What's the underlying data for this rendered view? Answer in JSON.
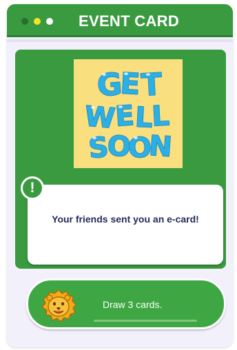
{
  "window": {
    "title": "EVENT CARD",
    "controls": [
      "window-dot-dark",
      "window-dot-yellow",
      "window-dot-white"
    ]
  },
  "event_card": {
    "artwork_text": "GET WELL SOON",
    "alert_glyph": "!",
    "message": "Your friends sent you an e-card!"
  },
  "action": {
    "icon": "lion-face-icon",
    "label": "Draw 3 cards."
  },
  "colors": {
    "green": "#3a9a3f",
    "button_green": "#3ea743",
    "card_background": "#f9df7e",
    "lettering_blue": "#2bb0e6",
    "message_text": "#222a5c",
    "lion_orange": "#f4ab1a"
  }
}
